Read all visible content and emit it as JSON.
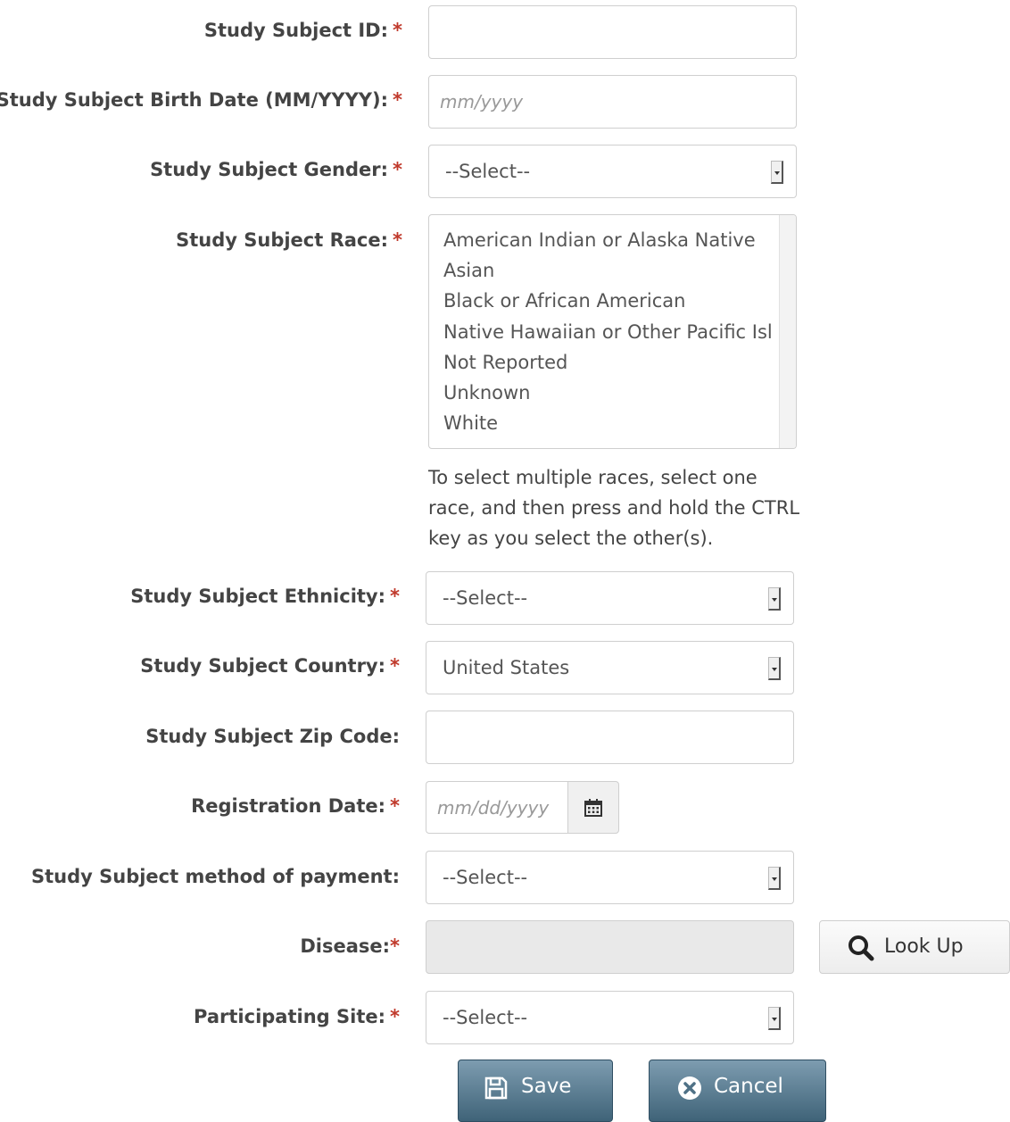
{
  "fields": {
    "subject_id": {
      "label": "Study Subject ID:",
      "required_mark": "*",
      "value": ""
    },
    "birth_date": {
      "label": "Study Subject Birth Date (MM/YYYY):",
      "required_mark": "*",
      "placeholder": "mm/yyyy"
    },
    "gender": {
      "label": "Study Subject Gender:",
      "required_mark": "*",
      "selected": "--Select--"
    },
    "race": {
      "label": "Study Subject Race:",
      "required_mark": "*",
      "options": [
        "American Indian or Alaska Native",
        "Asian",
        "Black or African American",
        "Native Hawaiian or Other Pacific Isl",
        "Not Reported",
        "Unknown",
        "White"
      ],
      "help": "To select multiple races, select one race, and then press and hold the CTRL key as you select the other(s)."
    },
    "ethnicity": {
      "label": "Study Subject Ethnicity:",
      "required_mark": "*",
      "selected": "--Select--"
    },
    "country": {
      "label": "Study Subject Country:",
      "required_mark": "*",
      "selected": "United States"
    },
    "zip": {
      "label": "Study Subject Zip Code:",
      "value": ""
    },
    "registration_date": {
      "label": "Registration Date:",
      "required_mark": "*",
      "placeholder": "mm/dd/yyyy"
    },
    "payment": {
      "label": "Study Subject method of payment:",
      "selected": "--Select--"
    },
    "disease": {
      "label": "Disease:",
      "required_mark": "*",
      "value": ""
    },
    "site": {
      "label": "Participating Site:",
      "required_mark": "*",
      "selected": "--Select--"
    }
  },
  "buttons": {
    "lookup": "Look Up",
    "save": "Save",
    "cancel": "Cancel"
  },
  "colors": {
    "required": "#c0392b",
    "button_dark": "#4f7186"
  },
  "icons": [
    "chevron-down-icon",
    "calendar-icon",
    "search-icon",
    "save-icon",
    "cancel-icon"
  ]
}
